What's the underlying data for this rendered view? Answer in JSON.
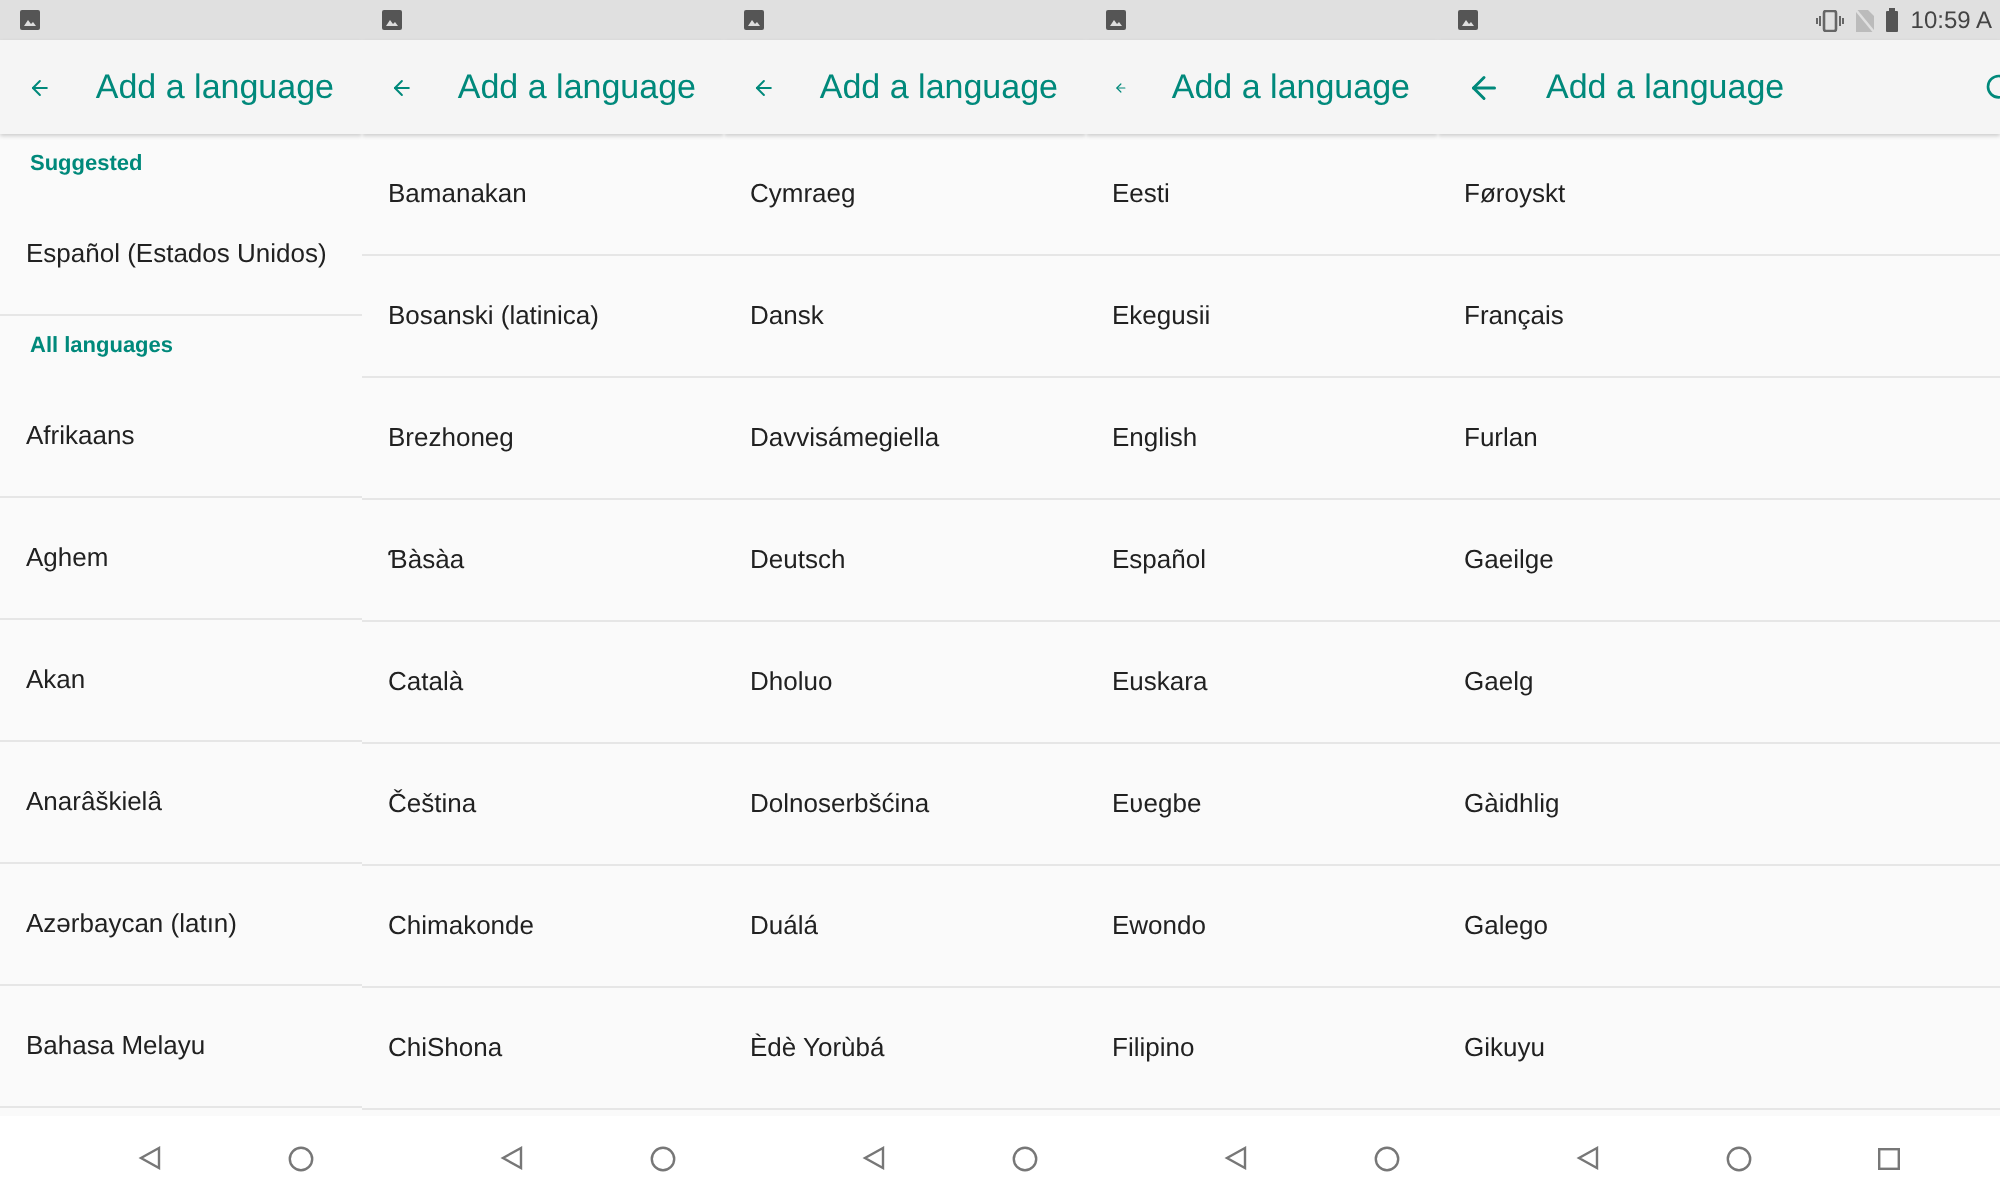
{
  "panels": [
    {
      "title": "Add a language",
      "items": [
        {
          "kind": "header",
          "label": "Suggested"
        },
        {
          "kind": "language",
          "label": "Español (Estados Unidos)"
        },
        {
          "kind": "header",
          "label": "All languages"
        },
        {
          "kind": "language",
          "label": "Afrikaans"
        },
        {
          "kind": "language",
          "label": "Aghem"
        },
        {
          "kind": "language",
          "label": "Akan"
        },
        {
          "kind": "language",
          "label": "Anarâškielâ"
        },
        {
          "kind": "language",
          "label": "Azərbaycan (latın)"
        },
        {
          "kind": "language",
          "label": "Bahasa Melayu"
        }
      ]
    },
    {
      "title": "Add a language",
      "items": [
        {
          "kind": "language",
          "label": "Bamanakan"
        },
        {
          "kind": "language",
          "label": "Bosanski (latinica)"
        },
        {
          "kind": "language",
          "label": "Brezhoneg"
        },
        {
          "kind": "language",
          "label": "Ɓàsàa"
        },
        {
          "kind": "language",
          "label": "Català"
        },
        {
          "kind": "language",
          "label": "Čeština"
        },
        {
          "kind": "language",
          "label": "Chimakonde"
        },
        {
          "kind": "language",
          "label": "ChiShona"
        }
      ]
    },
    {
      "title": "Add a language",
      "items": [
        {
          "kind": "language",
          "label": "Cymraeg"
        },
        {
          "kind": "language",
          "label": "Dansk"
        },
        {
          "kind": "language",
          "label": "Davvisámegiella"
        },
        {
          "kind": "language",
          "label": "Deutsch"
        },
        {
          "kind": "language",
          "label": "Dholuo"
        },
        {
          "kind": "language",
          "label": "Dolnoserbšćina"
        },
        {
          "kind": "language",
          "label": "Duálá"
        },
        {
          "kind": "language",
          "label": "Èdè Yorùbá"
        }
      ]
    },
    {
      "title": "Add a language",
      "items": [
        {
          "kind": "language",
          "label": "Eesti"
        },
        {
          "kind": "language",
          "label": "Ekegusii"
        },
        {
          "kind": "language",
          "label": "English"
        },
        {
          "kind": "language",
          "label": "Español"
        },
        {
          "kind": "language",
          "label": "Euskara"
        },
        {
          "kind": "language",
          "label": "Eʋegbe"
        },
        {
          "kind": "language",
          "label": "Ewondo"
        },
        {
          "kind": "language",
          "label": "Filipino"
        }
      ]
    },
    {
      "title": "Add a language",
      "status_time": "10:59 A",
      "items": [
        {
          "kind": "language",
          "label": "Føroyskt"
        },
        {
          "kind": "language",
          "label": "Français"
        },
        {
          "kind": "language",
          "label": "Furlan"
        },
        {
          "kind": "language",
          "label": "Gaeilge"
        },
        {
          "kind": "language",
          "label": "Gaelg"
        },
        {
          "kind": "language",
          "label": "Gàidhlig"
        },
        {
          "kind": "language",
          "label": "Galego"
        },
        {
          "kind": "language",
          "label": "Gikuyu"
        }
      ]
    }
  ]
}
